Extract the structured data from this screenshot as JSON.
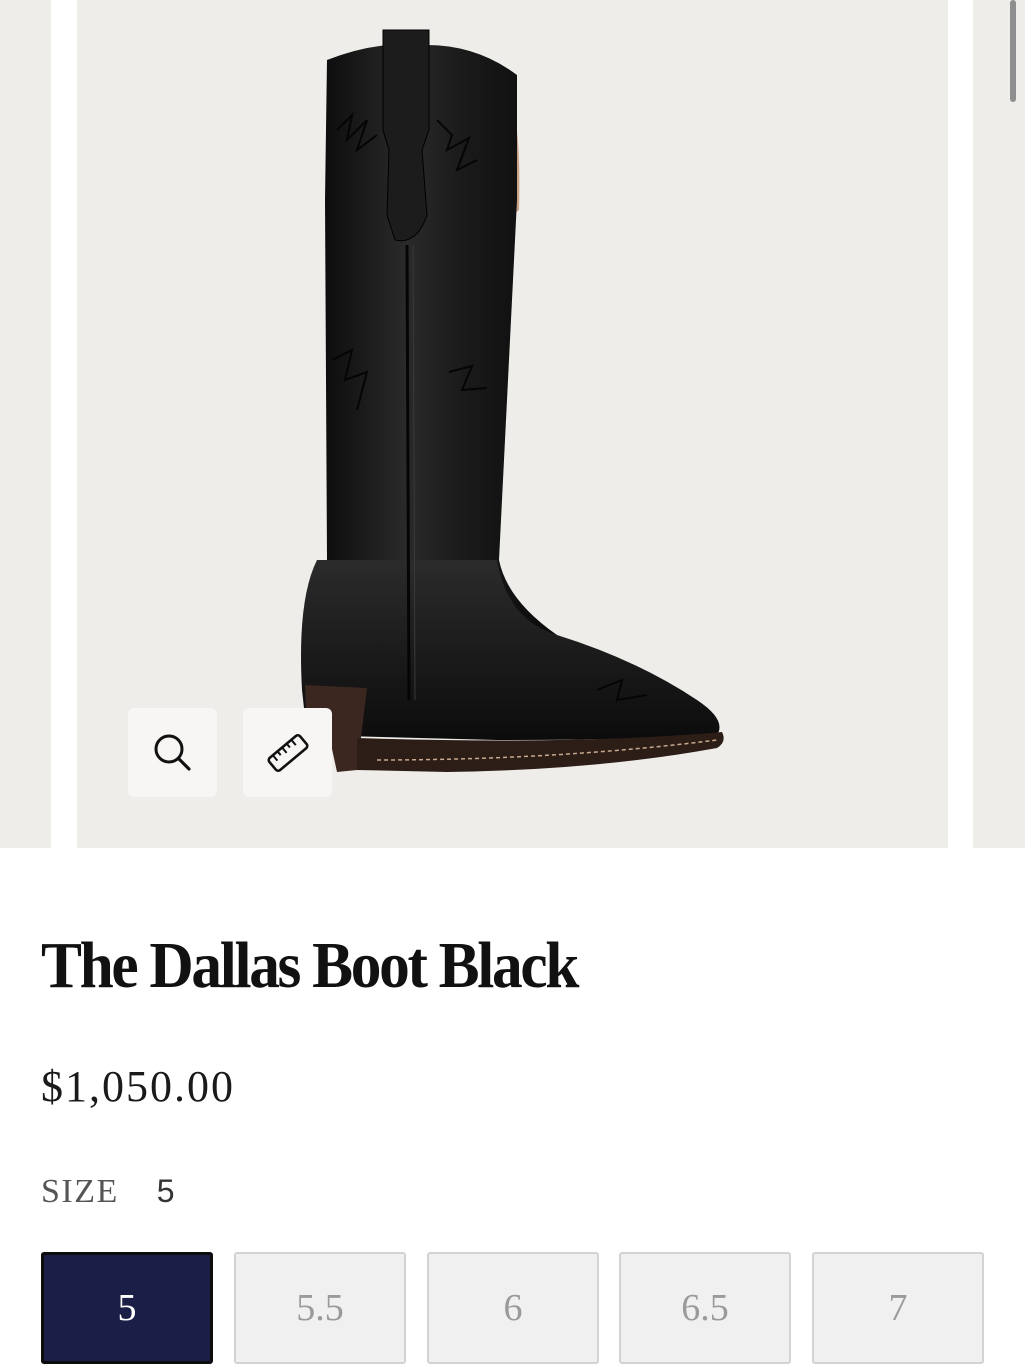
{
  "product": {
    "title": "The Dallas Boot Black",
    "price": "$1,050.00",
    "image_alt": "Black knee-high leather western boot with stitched shaft design"
  },
  "gallery": {
    "icons": [
      "zoom-search-icon",
      "ruler-icon"
    ]
  },
  "size": {
    "label": "SIZE",
    "selected": "5",
    "options": [
      "5",
      "5.5",
      "6",
      "6.5",
      "7"
    ]
  },
  "colors": {
    "image_bg": "#eeede9",
    "selected_size_bg": "#1b1f47",
    "unselected_size_bg": "#f0f0f0"
  }
}
